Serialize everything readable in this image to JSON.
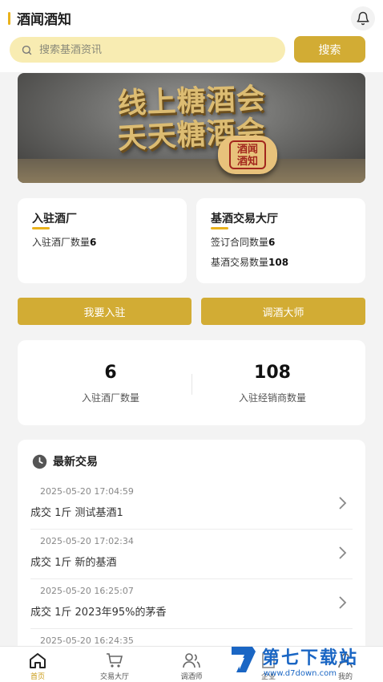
{
  "header": {
    "title": "酒闻酒知",
    "bell_icon": "bell-icon"
  },
  "search": {
    "placeholder": "搜索基酒资讯",
    "button_label": "搜索"
  },
  "banner": {
    "line1": "线上糖酒会",
    "line2": "天天糖酒会",
    "seal_text_1": "酒闻",
    "seal_text_2": "酒知"
  },
  "factory_card": {
    "title": "入驻酒厂",
    "stat_label": "入驻酒厂数量",
    "stat_value": "6"
  },
  "exchange_card": {
    "title": "基酒交易大厅",
    "stat1_label": "签订合同数量",
    "stat1_value": "6",
    "stat2_label": "基酒交易数量",
    "stat2_value": "108"
  },
  "actions": {
    "join_label": "我要入驻",
    "master_label": "调酒大师"
  },
  "stats": {
    "factories_value": "6",
    "factories_label": "入驻酒厂数量",
    "dealers_value": "108",
    "dealers_label": "入驻经销商数量"
  },
  "latest": {
    "title": "最新交易",
    "items": [
      {
        "time": "2025-05-20 17:04:59",
        "desc": "成交 1斤 测试基酒1"
      },
      {
        "time": "2025-05-20 17:02:34",
        "desc": "成交 1斤 新的基酒"
      },
      {
        "time": "2025-05-20 16:25:07",
        "desc": "成交 1斤 2023年95%的茅香"
      },
      {
        "time": "2025-05-20 16:24:35",
        "desc": ""
      }
    ]
  },
  "tabbar": {
    "tabs": [
      {
        "label": "首页",
        "icon": "home-icon",
        "active": true
      },
      {
        "label": "交易大厅",
        "icon": "cart-icon"
      },
      {
        "label": "调酒师",
        "icon": "people-icon"
      },
      {
        "label": "企业",
        "icon": "building-icon"
      },
      {
        "label": "我的",
        "icon": "user-icon"
      }
    ]
  },
  "watermark": {
    "text": "第七下载站",
    "url": "www.d7down.com"
  },
  "colors": {
    "accent": "#d2ac34",
    "accent_light": "#f8ecb2",
    "title_bar": "#e9b21c",
    "watermark_blue": "#1a66c4"
  }
}
